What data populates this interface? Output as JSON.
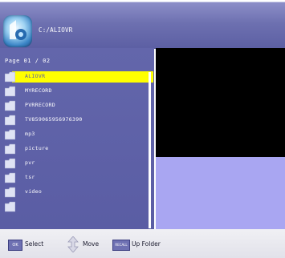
{
  "header": {
    "path": "C:/ALIOVR",
    "logo_icon": "device-logo-icon"
  },
  "browser": {
    "page_indicator": "Page  01 / 02",
    "items": [
      {
        "label": "ALIOVR",
        "selected": true
      },
      {
        "label": "MYRECORD",
        "selected": false
      },
      {
        "label": "PVRRECORD",
        "selected": false
      },
      {
        "label": "TV859065956976390",
        "selected": false
      },
      {
        "label": "mp3",
        "selected": false
      },
      {
        "label": "picture",
        "selected": false
      },
      {
        "label": "pvr",
        "selected": false
      },
      {
        "label": "tsr",
        "selected": false
      },
      {
        "label": "video",
        "selected": false
      },
      {
        "label": "",
        "selected": false
      }
    ],
    "highlight_color": "#ffff00"
  },
  "footer": {
    "ok_key": "OK",
    "select_label": "Select",
    "move_label": "Move",
    "recall_key": "RECALL",
    "up_folder_label": "Up Folder"
  },
  "colors": {
    "panel": "#5c5fa3",
    "preview_video": "#000000",
    "preview_info": "#a9a6f2"
  }
}
